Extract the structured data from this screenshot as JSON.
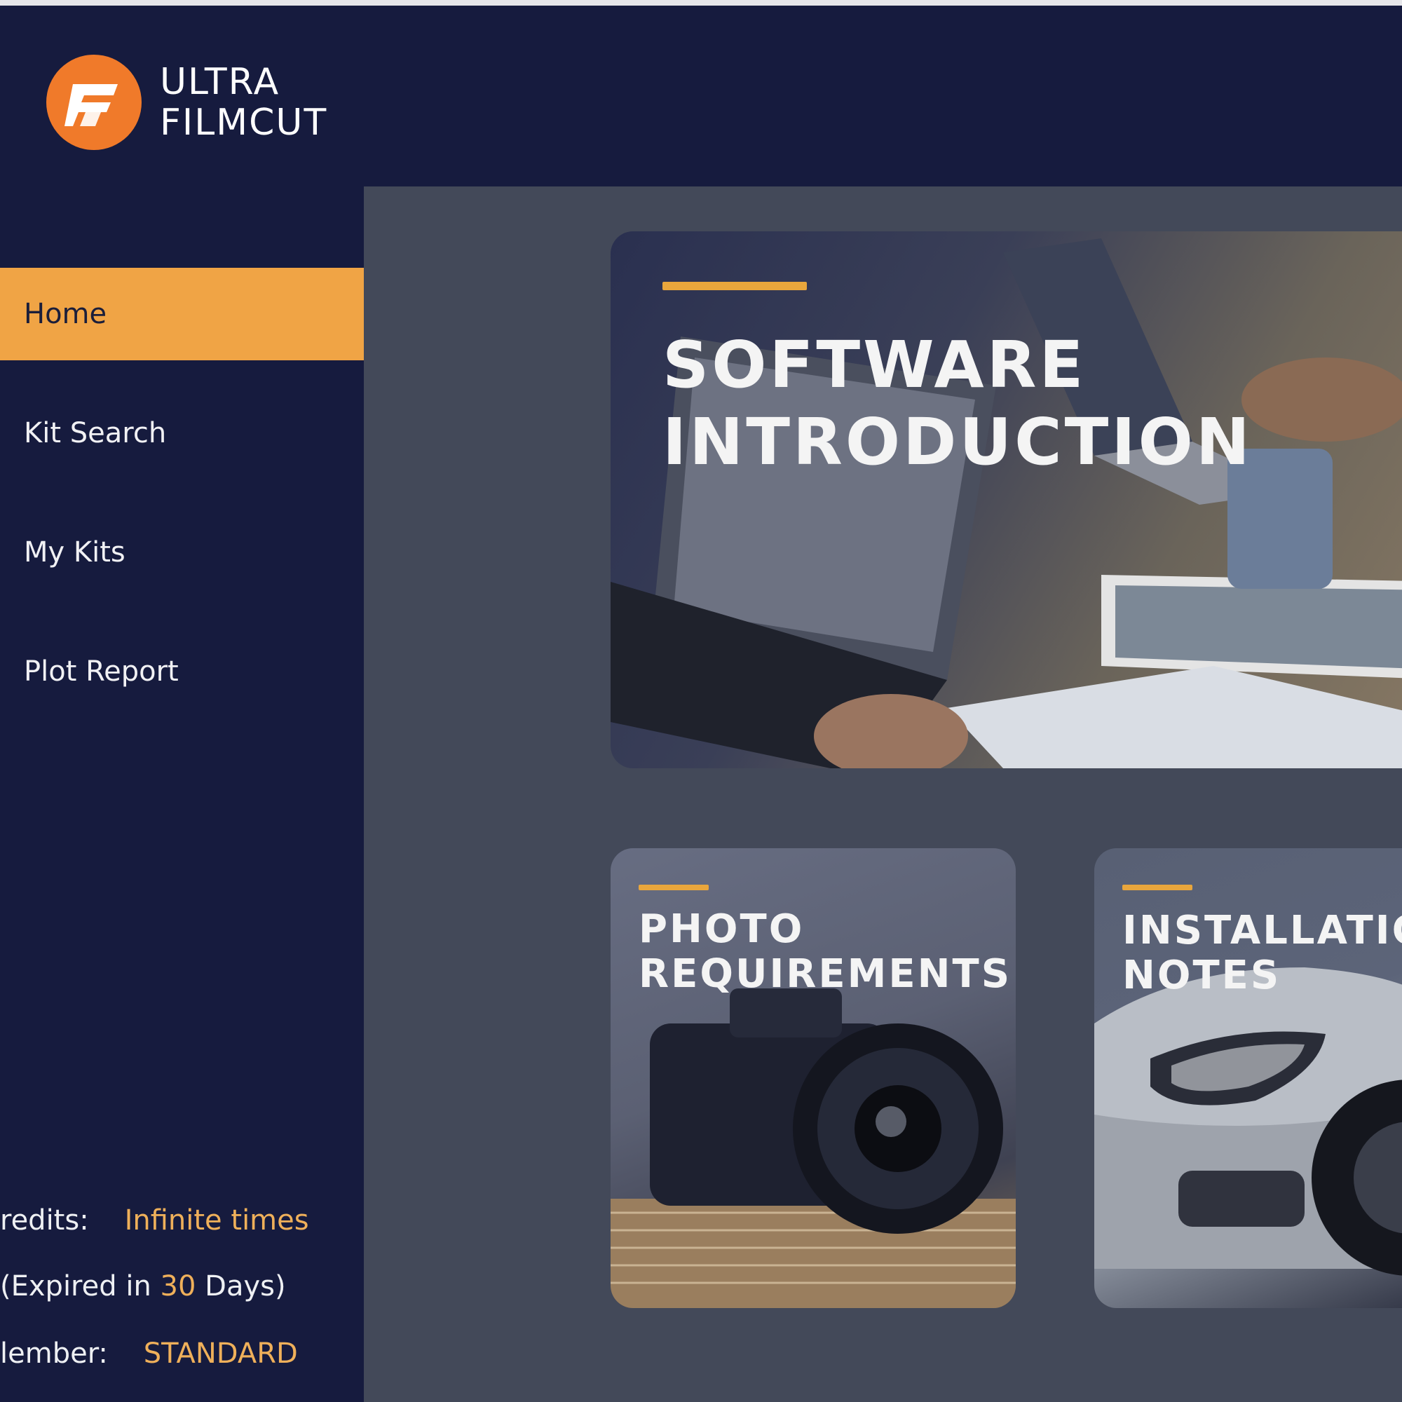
{
  "brand": {
    "line1": "ULTRA",
    "line2": "FILMCUT",
    "accent_color": "#f07a2a"
  },
  "nav": {
    "items": [
      {
        "label": "Home",
        "active": true
      },
      {
        "label": "Kit Search",
        "active": false
      },
      {
        "label": "My Kits",
        "active": false
      },
      {
        "label": "Plot Report",
        "active": false
      }
    ],
    "active_color": "#f0a445"
  },
  "account": {
    "credits_label": "redits:",
    "credits_value": "Infinite times",
    "expiry_prefix": "(Expired in ",
    "expiry_days": "30",
    "expiry_suffix": " Days)",
    "member_label": "lember:",
    "member_value": "STANDARD"
  },
  "cards": {
    "intro": {
      "line1": "SOFTWARE",
      "line2": "INTRODUCTION"
    },
    "photo": {
      "line1": "PHOTO",
      "line2": "REQUIREMENTS"
    },
    "install": {
      "line1": "INSTALLATION",
      "line2": "NOTES"
    }
  },
  "icons": {
    "logo": "ultra-filmcut-logo-icon",
    "laptop": "laptop-icon",
    "camera": "camera-icon",
    "car": "car-icon"
  },
  "colors": {
    "background": "#161b3e",
    "panel": "#434959",
    "accent_bar": "#e9a63c",
    "value_text": "#efb05a"
  }
}
